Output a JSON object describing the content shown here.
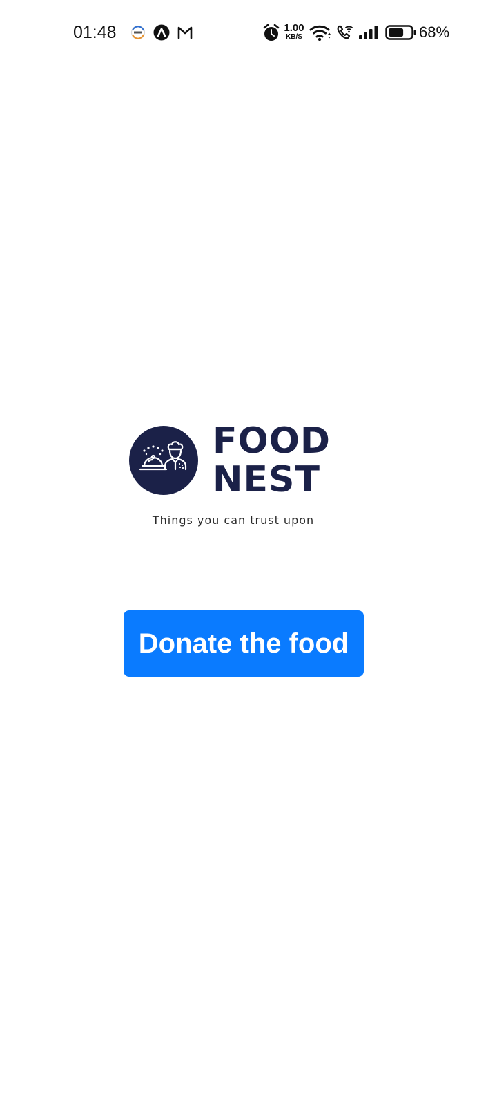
{
  "status_bar": {
    "time": "01:48",
    "notification_icons": [
      "news-app-icon",
      "arc-app-icon",
      "gmail-icon"
    ],
    "network_speed_value": "1.00",
    "network_speed_unit": "KB/S",
    "system_icons": [
      "alarm-icon",
      "wifi-icon",
      "wifi-calling-icon",
      "signal-icon",
      "battery-icon"
    ],
    "battery_level": 0.68,
    "battery_percent": "68%"
  },
  "logo": {
    "icon": "chef-serving-cloche-icon",
    "brand_line_1": "FOOD",
    "brand_line_2": "NEST",
    "tagline": "Things you can trust upon"
  },
  "cta": {
    "label": "Donate the food"
  },
  "colors": {
    "brand_navy": "#1b2148",
    "button_blue": "#0a7bff",
    "background": "#ffffff"
  }
}
